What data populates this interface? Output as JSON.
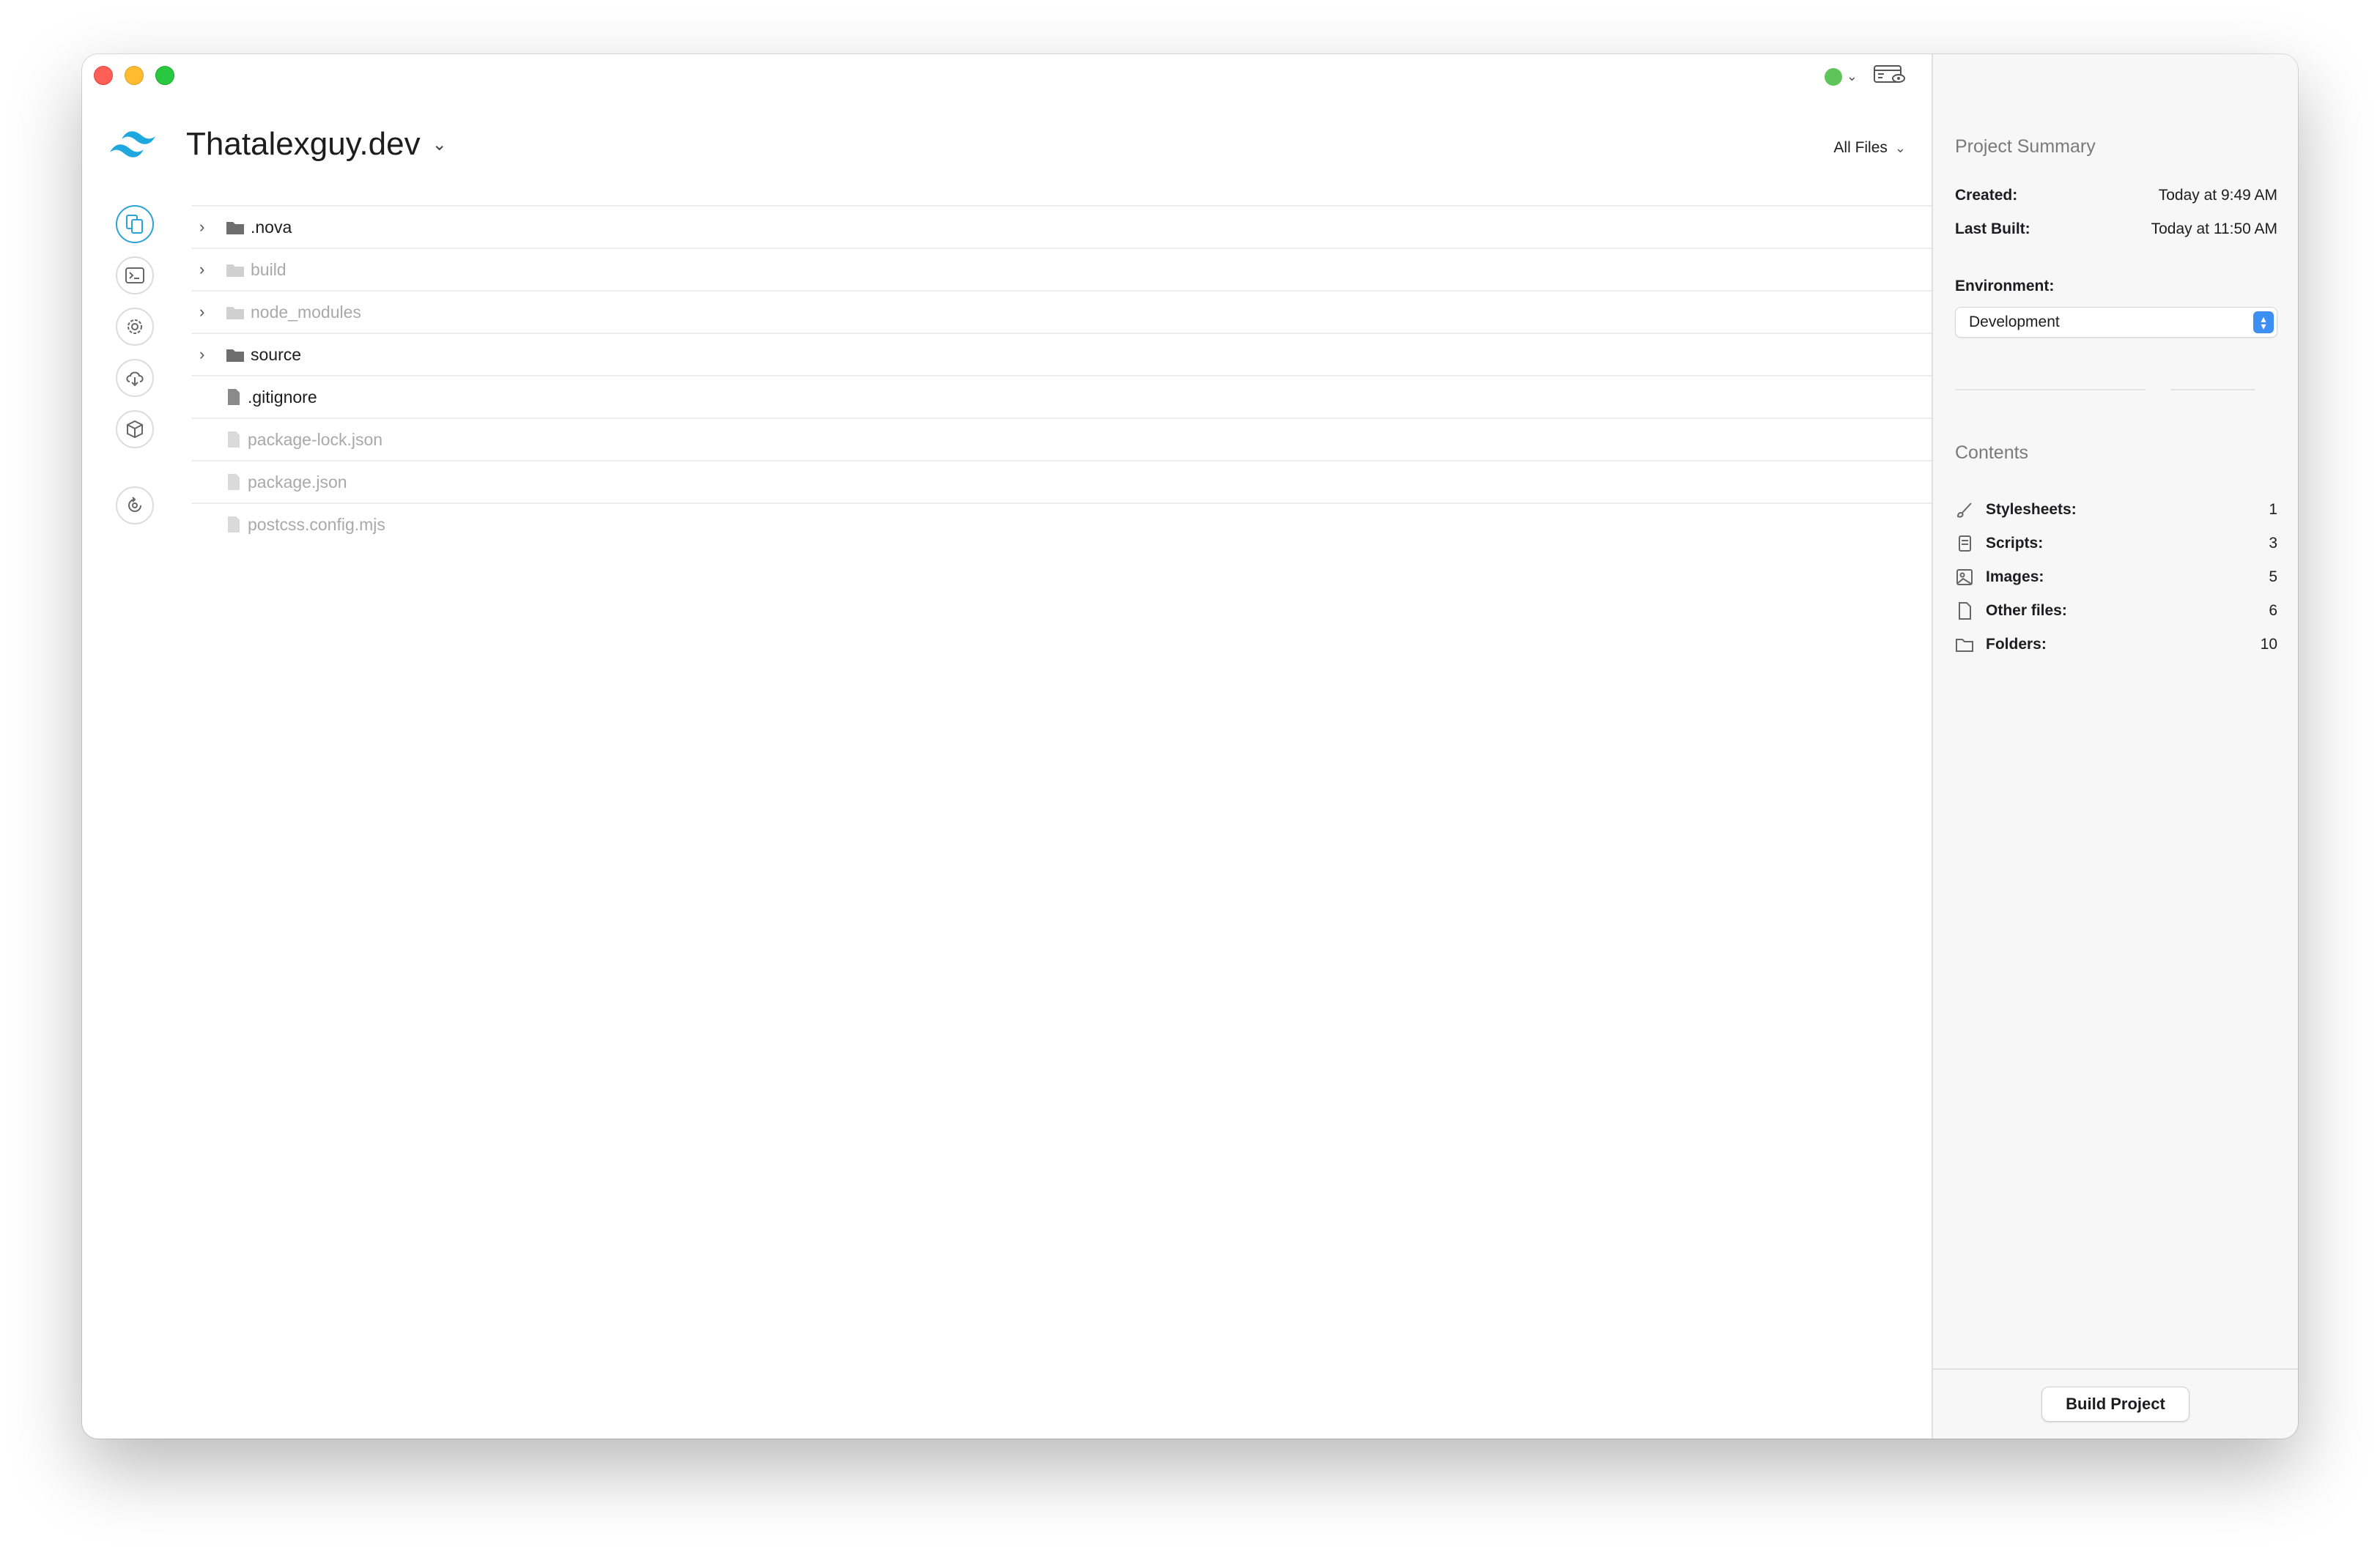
{
  "window": {
    "traffic_lights": [
      "close",
      "minimize",
      "zoom"
    ]
  },
  "toolbar": {
    "status_color": "#5ec55a",
    "preview_icon": "preview-eye-icon"
  },
  "project": {
    "name": "Thatalexguy.dev",
    "logo": "tailwind-logo-icon",
    "filter_label": "All Files"
  },
  "rail": [
    {
      "icon": "files-icon",
      "active": true
    },
    {
      "icon": "terminal-icon",
      "active": false
    },
    {
      "icon": "settings-gear-icon",
      "active": false
    },
    {
      "icon": "cloud-publish-icon",
      "active": false
    },
    {
      "icon": "package-box-icon",
      "active": false
    },
    {
      "icon": "sync-icon",
      "active": false
    }
  ],
  "files": [
    {
      "name": ".nova",
      "type": "folder",
      "dim": false
    },
    {
      "name": "build",
      "type": "folder",
      "dim": true
    },
    {
      "name": "node_modules",
      "type": "folder",
      "dim": true
    },
    {
      "name": "source",
      "type": "folder",
      "dim": false
    },
    {
      "name": ".gitignore",
      "type": "file",
      "dim": false
    },
    {
      "name": "package-lock.json",
      "type": "file",
      "dim": true
    },
    {
      "name": "package.json",
      "type": "file",
      "dim": true
    },
    {
      "name": "postcss.config.mjs",
      "type": "file",
      "dim": true
    }
  ],
  "summary": {
    "heading": "Project Summary",
    "created_label": "Created:",
    "created_value": "Today at 9:49 AM",
    "built_label": "Last Built:",
    "built_value": "Today at 11:50 AM",
    "env_label": "Environment:",
    "env_value": "Development"
  },
  "contents": {
    "heading": "Contents",
    "items": [
      {
        "label": "Stylesheets:",
        "value": "1",
        "icon": "stylesheet-brush-icon"
      },
      {
        "label": "Scripts:",
        "value": "3",
        "icon": "script-scroll-icon"
      },
      {
        "label": "Images:",
        "value": "5",
        "icon": "image-icon"
      },
      {
        "label": "Other files:",
        "value": "6",
        "icon": "document-icon"
      },
      {
        "label": "Folders:",
        "value": "10",
        "icon": "folder-icon"
      }
    ]
  },
  "footer": {
    "build_label": "Build Project"
  }
}
